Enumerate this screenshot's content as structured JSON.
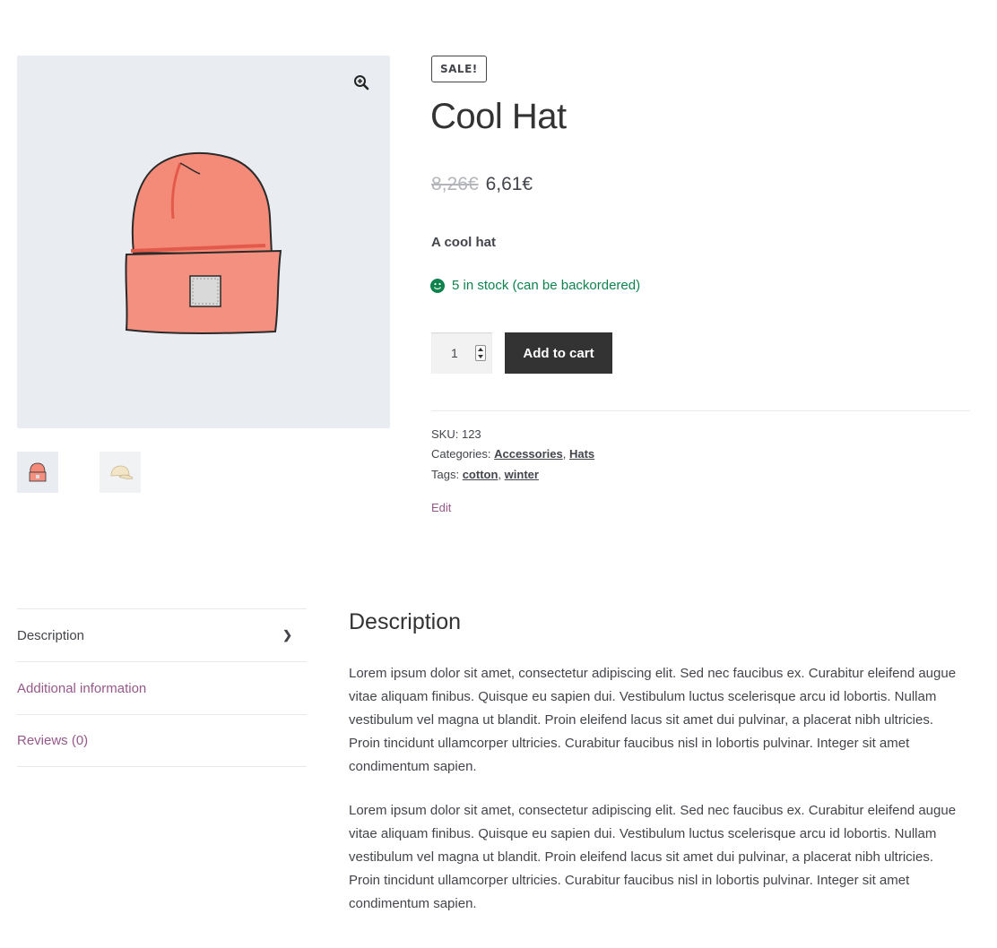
{
  "gallery": {
    "zoom_icon": "zoom-in-icon",
    "main_image_alt": "red beanie hat",
    "thumbnails": [
      "red beanie thumbnail",
      "cream cap thumbnail"
    ]
  },
  "product": {
    "badge": "SALE!",
    "title": "Cool Hat",
    "price_old": "8,26€",
    "price_new": "6,61€",
    "short_description": "A cool hat",
    "stock": "5 in stock (can be backordered)",
    "quantity": "1",
    "add_to_cart": "Add to cart",
    "sku_label": "SKU:",
    "sku": "123",
    "categories_label": "Categories:",
    "categories": [
      "Accessories",
      "Hats"
    ],
    "tags_label": "Tags:",
    "tags": [
      "cotton",
      "winter"
    ],
    "edit": "Edit"
  },
  "tabs": [
    {
      "label": "Description",
      "active": true
    },
    {
      "label": "Additional information",
      "active": false
    },
    {
      "label": "Reviews (0)",
      "active": false
    }
  ],
  "panel": {
    "title": "Description",
    "paragraphs": [
      "Lorem ipsum dolor sit amet, consectetur adipiscing elit. Sed nec faucibus ex. Curabitur eleifend augue vitae aliquam finibus. Quisque eu sapien dui. Vestibulum luctus scelerisque arcu id lobortis. Nullam vestibulum vel magna ut blandit. Proin eleifend lacus sit amet dui pulvinar, a placerat nibh ultricies. Proin tincidunt ullamcorper ultricies. Curabitur faucibus nisl in lobortis pulvinar. Integer sit amet condimentum sapien.",
      "Lorem ipsum dolor sit amet, consectetur adipiscing elit. Sed nec faucibus ex. Curabitur eleifend augue vitae aliquam finibus. Quisque eu sapien dui. Vestibulum luctus scelerisque arcu id lobortis. Nullam vestibulum vel magna ut blandit. Proin eleifend lacus sit amet dui pulvinar, a placerat nibh ultricies. Proin tincidunt ullamcorper ultricies. Curabitur faucibus nisl in lobortis pulvinar. Integer sit amet condimentum sapien."
    ]
  },
  "colors": {
    "accent": "#96588a",
    "stock": "#0f834d",
    "button": "#333333",
    "gallery_bg": "#e9edf1"
  }
}
